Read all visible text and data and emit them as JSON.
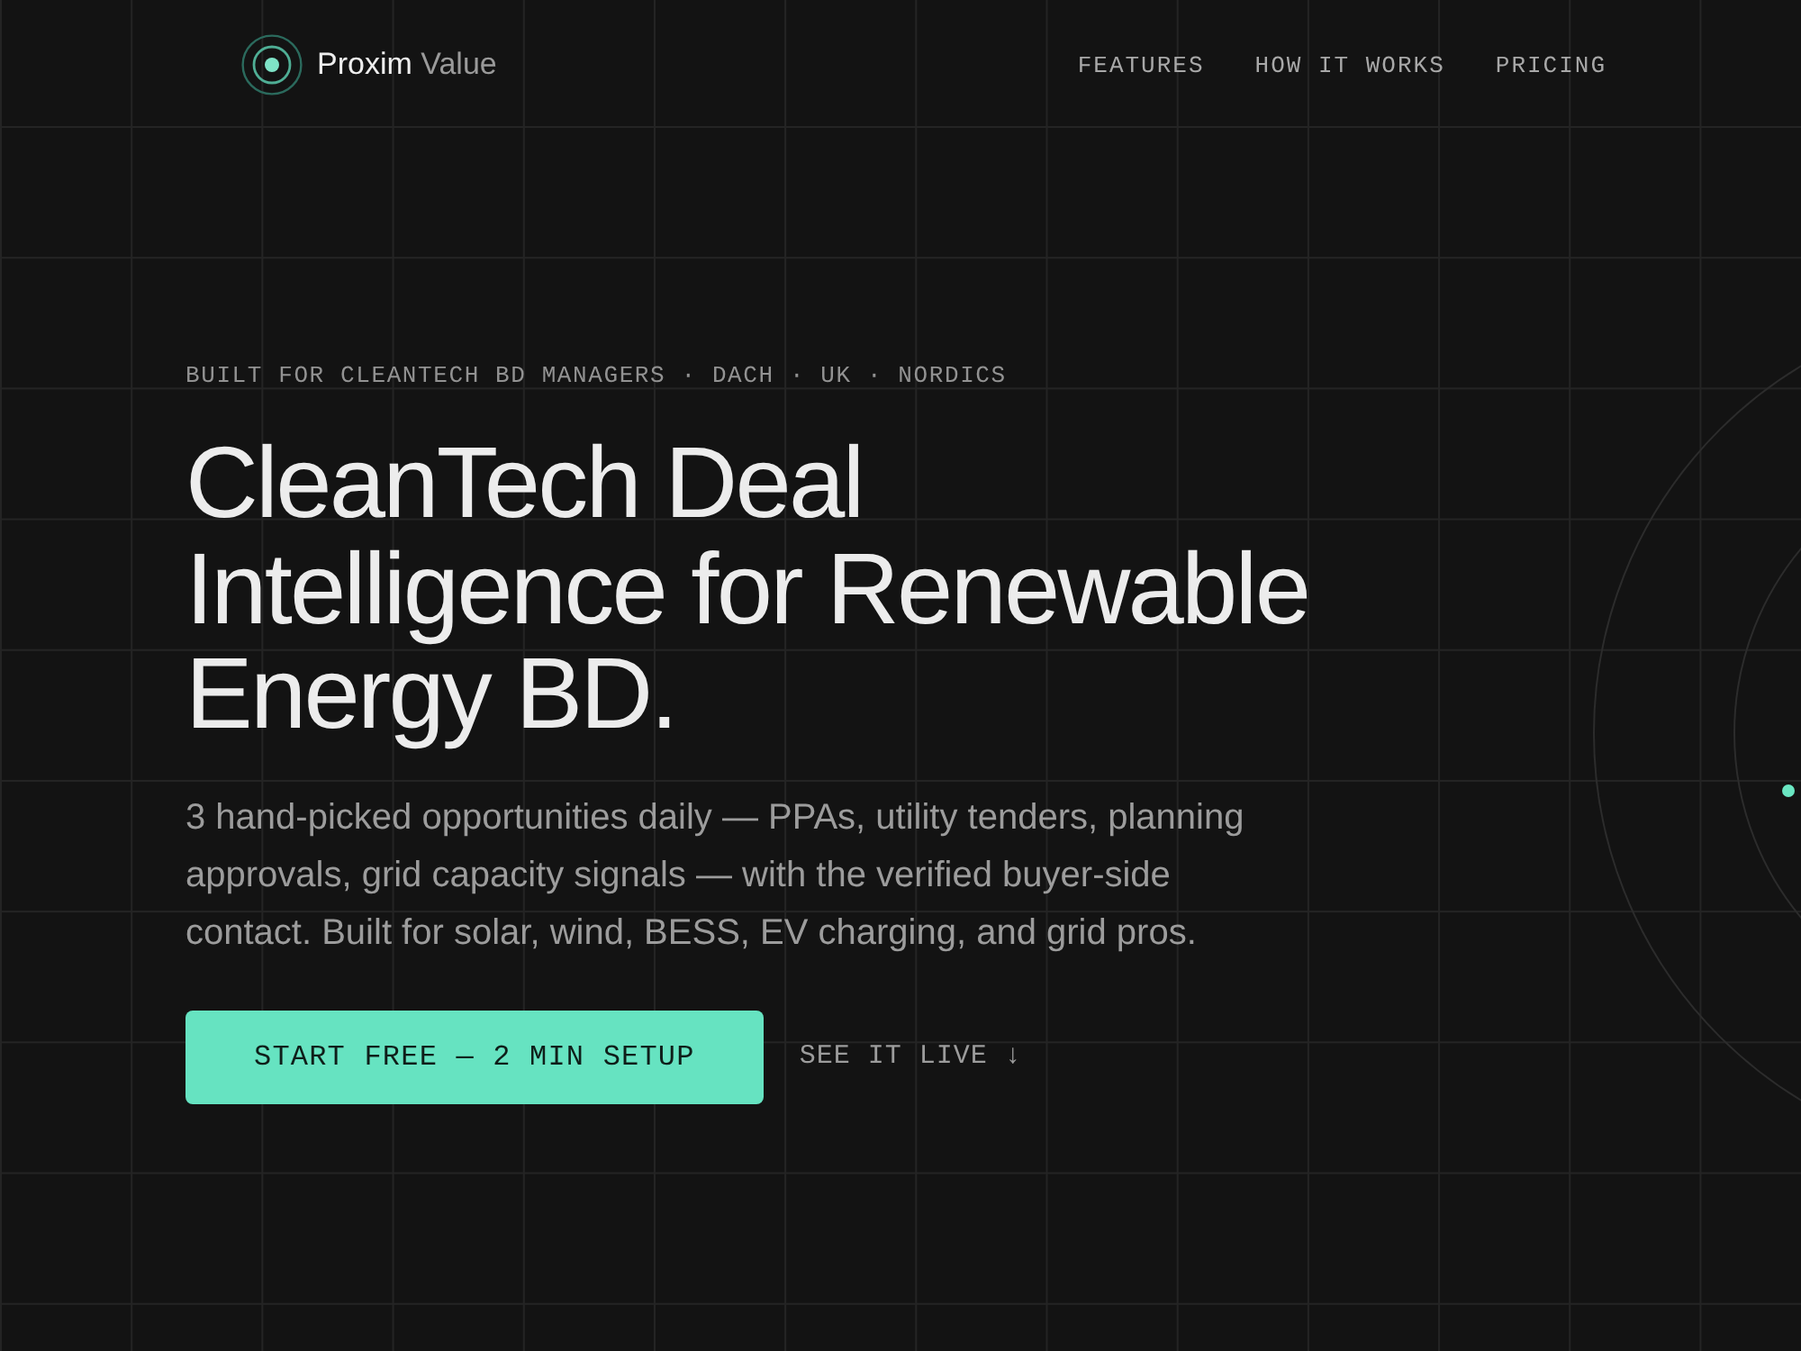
{
  "header": {
    "logo": {
      "name": "Proxim",
      "suffix": "Value"
    },
    "nav": [
      "FEATURES",
      "HOW IT WORKS",
      "PRICING"
    ]
  },
  "hero": {
    "eyebrow": "BUILT FOR CLEANTECH BD MANAGERS · DACH · UK · NORDICS",
    "headline": "CleanTech Deal Intelligence for Renewable Energy BD.",
    "description": "3 hand-picked opportunities daily — PPAs, utility tenders, planning approvals, grid capacity signals — with the verified buyer-side contact. Built for solar, wind, BESS, EV charging, and grid pros.",
    "primary_button": "START FREE — 2 MIN SETUP",
    "secondary_link": "SEE IT LIVE ↓"
  }
}
